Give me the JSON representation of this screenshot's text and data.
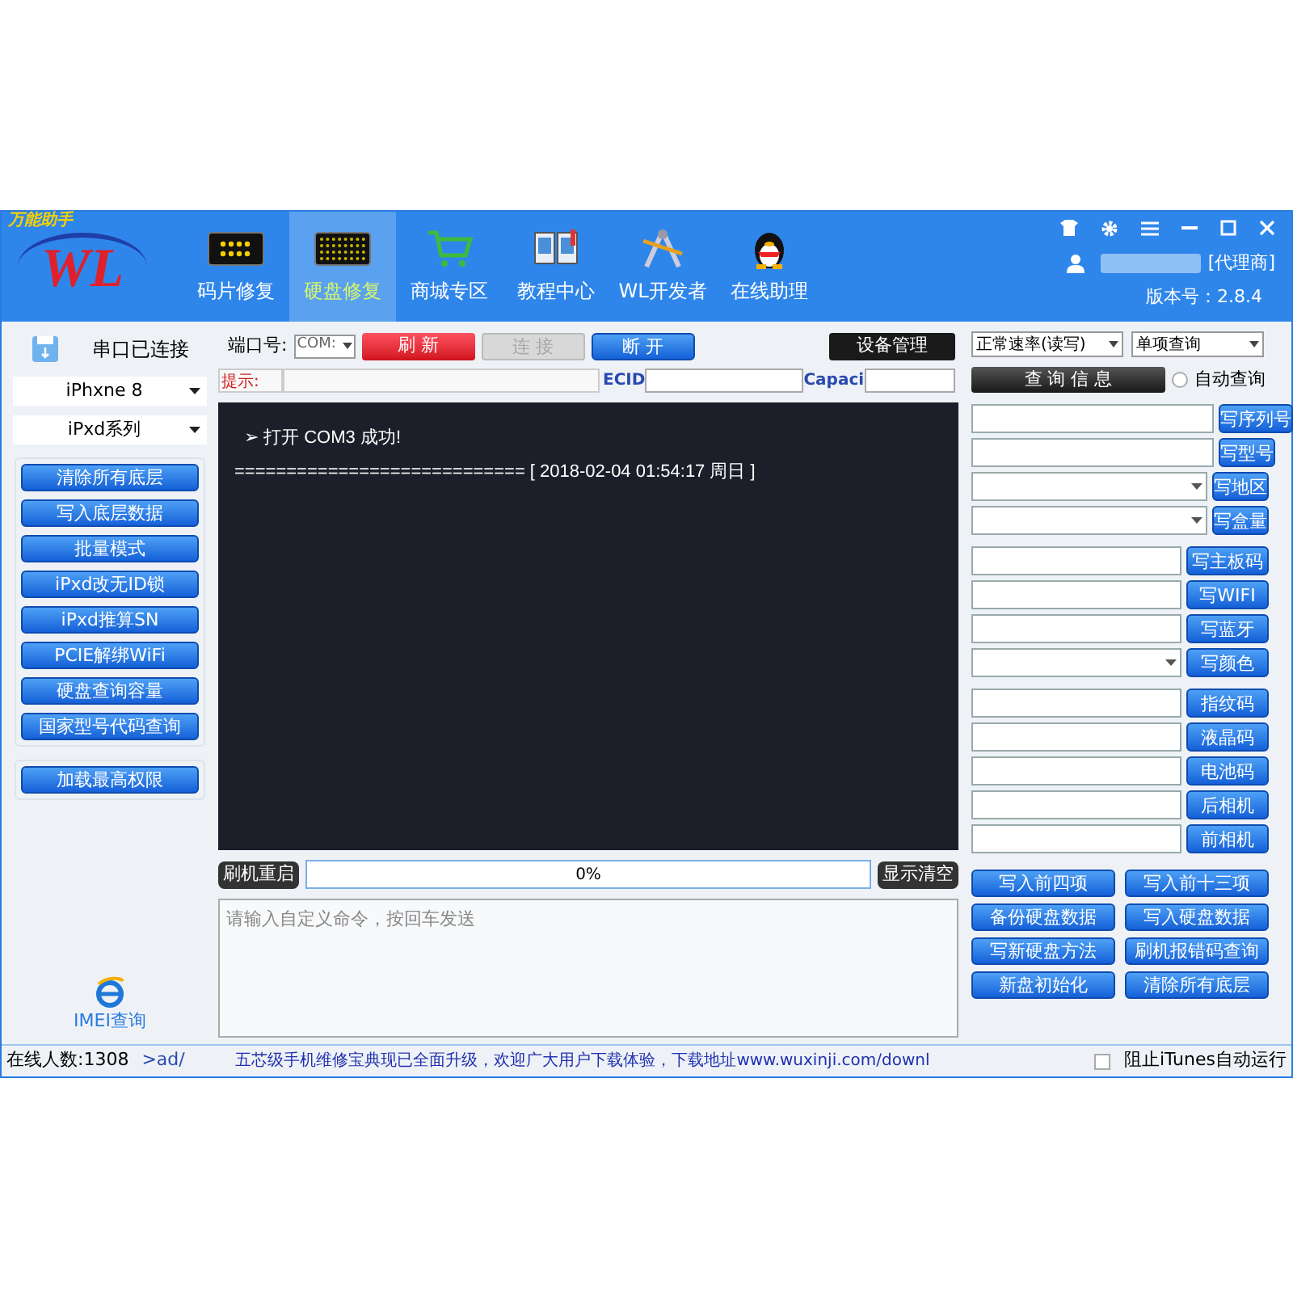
{
  "header": {
    "logo_tagline": "万能助手",
    "logo_text": "WL",
    "tabs": [
      {
        "label": "码片修复",
        "selected": false
      },
      {
        "label": "硬盘修复",
        "selected": true
      },
      {
        "label": "商城专区",
        "selected": false
      },
      {
        "label": "教程中心",
        "selected": false
      },
      {
        "label": "WL开发者",
        "selected": false
      },
      {
        "label": "在线助理",
        "selected": false
      }
    ],
    "user_role": "[代理商]",
    "version": "版本号：2.8.4"
  },
  "left": {
    "connection": "串口已连接",
    "model": "iPhxne 8",
    "series": "iPxd系列",
    "buttons": [
      "清除所有底层",
      "写入底层数据",
      "批量模式",
      "iPxd改无ID锁",
      "iPxd推算SN",
      "PCIE解绑WiFi",
      "硬盘查询容量",
      "国家型号代码查询"
    ],
    "extra_button": "加载最高权限",
    "imei_link": "IMEI查询"
  },
  "center": {
    "port_label": "端口号:",
    "port_value": "COM:",
    "refresh": "刷 新",
    "connect": {
      "label": "连 接",
      "disabled": true
    },
    "disconnect": "断 开",
    "device_manager": "设备管理",
    "hint_label": "提示:",
    "ecid_label": "ECID",
    "capacity_label": "Capaci",
    "console_lines": [
      "➢ 打开 COM3 成功!",
      "============================ [ 2018-02-04 01:54:17 周日 ]"
    ],
    "flash_restart": "刷机重启",
    "progress": {
      "level": 0,
      "text": "0%"
    },
    "clear_display": "显示清空",
    "command_placeholder": "请输入自定义命令，按回车发送"
  },
  "right": {
    "speed": "正常速率(读写)",
    "mode": "单项查询",
    "query": "查 询 信 息",
    "auto_query": {
      "label": "自动查询",
      "selected": false
    },
    "groups": [
      [
        {
          "kind": "text",
          "button": "写序列号"
        },
        {
          "kind": "text",
          "button": "写型号"
        },
        {
          "kind": "select",
          "button": "写地区"
        },
        {
          "kind": "select",
          "button": "写盒量"
        }
      ],
      [
        {
          "kind": "text",
          "button": "写主板码"
        },
        {
          "kind": "text",
          "button": "写WIFI"
        },
        {
          "kind": "text",
          "button": "写蓝牙"
        },
        {
          "kind": "select",
          "button": "写颜色"
        }
      ],
      [
        {
          "kind": "text",
          "button": "指纹码"
        },
        {
          "kind": "text",
          "button": "液晶码"
        },
        {
          "kind": "text",
          "button": "电池码"
        },
        {
          "kind": "text",
          "button": "后相机"
        },
        {
          "kind": "text",
          "button": "前相机"
        }
      ]
    ],
    "actions": [
      "写入前四项",
      "写入前十三项",
      "备份硬盘数据",
      "写入硬盘数据",
      "写新硬盘方法",
      "刷机报错码查询",
      "新盘初始化",
      "清除所有底层"
    ]
  },
  "status": {
    "online": "在线人数:1308",
    "path": ">ad/",
    "marquee": "五芯级手机维修宝典现已全面升级，欢迎广大用户下载体验，下载地址www.wuxinji.com/downl",
    "block_itunes": {
      "label": "阻止iTunes自动运行",
      "checked": false
    }
  }
}
